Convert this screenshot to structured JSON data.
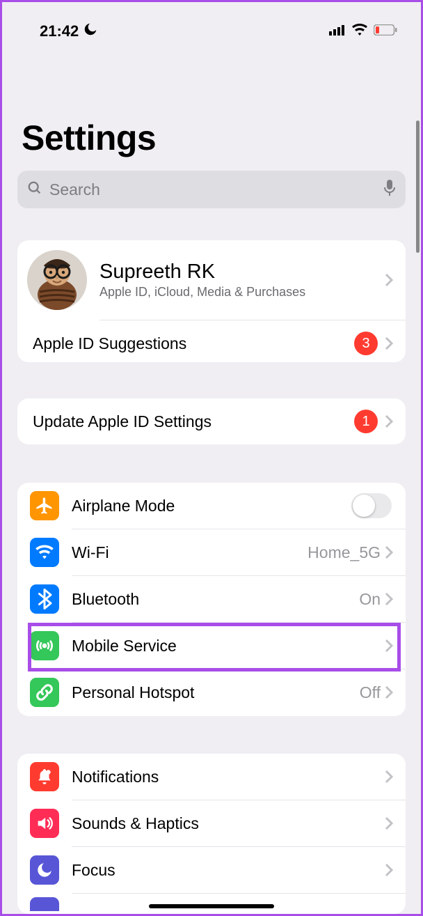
{
  "status": {
    "time": "21:42"
  },
  "page": {
    "title": "Settings",
    "search_placeholder": "Search"
  },
  "profile": {
    "name": "Supreeth RK",
    "subtitle": "Apple ID, iCloud, Media & Purchases"
  },
  "apple_id_suggestions": {
    "label": "Apple ID Suggestions",
    "badge": "3"
  },
  "update_row": {
    "label": "Update Apple ID Settings",
    "badge": "1"
  },
  "connectivity": {
    "airplane": "Airplane Mode",
    "wifi_label": "Wi-Fi",
    "wifi_value": "Home_5G",
    "bluetooth_label": "Bluetooth",
    "bluetooth_value": "On",
    "mobile_label": "Mobile Service",
    "hotspot_label": "Personal Hotspot",
    "hotspot_value": "Off"
  },
  "general": {
    "notifications": "Notifications",
    "sounds": "Sounds & Haptics",
    "focus": "Focus"
  }
}
